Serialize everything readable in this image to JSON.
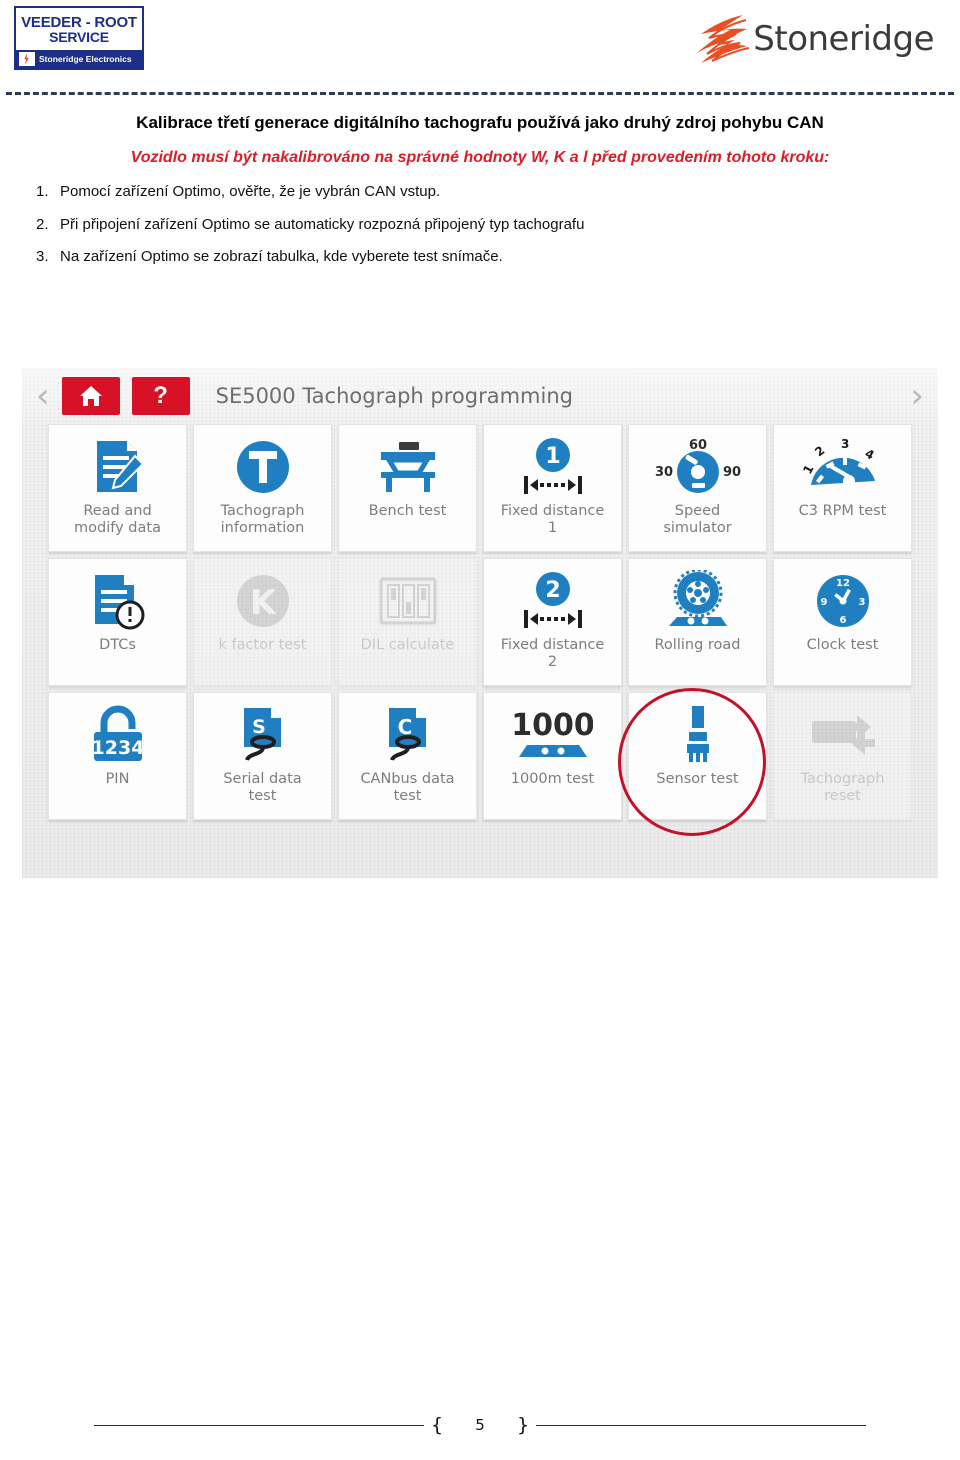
{
  "brand": {
    "veeder_root": {
      "line1": "VEEDER - ROOT",
      "line2": "SERVICE",
      "subtitle": "Stoneridge Electronics"
    },
    "stoneridge": {
      "wordmark": "Stoneridge",
      "mark_color": "#ea4f24"
    }
  },
  "document": {
    "headline": "Kalibrace třetí generace digitálního tachografu používá jako druhý zdroj pohybu CAN",
    "subline": "Vozidlo musí být nakalibrováno na správné hodnoty W, K a l před provedením tohoto kroku:",
    "steps": [
      {
        "num": "1.",
        "text": "Pomocí zařízení Optimo, ověřte, že je vybrán CAN vstup."
      },
      {
        "num": "2.",
        "text": "Při připojení zařízení Optimo se automaticky rozpozná připojený typ tachografu"
      },
      {
        "num": "3.",
        "text": "Na zařízení Optimo se zobrazí  tabulka, kde vyberete test snímače."
      }
    ],
    "page_number": "5",
    "footer_brace_left": "{",
    "footer_brace_right": "}"
  },
  "screenshot": {
    "toolbar": {
      "prev_label": "‹",
      "next_label": "›",
      "home_label": "home-button",
      "help_label": "?",
      "title": "SE5000 Tachograph programming"
    },
    "accent_red": "#d81226",
    "accent_blue": "#1f7fc0",
    "label_gray": "#7d7d7d",
    "tiles": [
      {
        "label": "Read and\nmodify data",
        "icon": "document-pencil-icon",
        "disabled": false
      },
      {
        "label": "Tachograph\ninformation",
        "icon": "tachograph-t-circle-icon",
        "disabled": false
      },
      {
        "label": "Bench test",
        "icon": "bench-icon",
        "disabled": false
      },
      {
        "label": "Fixed distance\n1",
        "icon": "fixed-distance-1-icon",
        "disabled": false
      },
      {
        "label": "Speed\nsimulator",
        "icon": "speed-dial-icon",
        "disabled": false
      },
      {
        "label": "C3 RPM test",
        "icon": "rpm-gauge-icon",
        "disabled": false
      },
      {
        "label": "DTCs",
        "icon": "document-warning-icon",
        "disabled": false
      },
      {
        "label": "k factor test",
        "icon": "k-circle-icon",
        "disabled": true
      },
      {
        "label": "DIL calculate",
        "icon": "dil-switches-icon",
        "disabled": true
      },
      {
        "label": "Fixed distance\n2",
        "icon": "fixed-distance-2-icon",
        "disabled": false
      },
      {
        "label": "Rolling road",
        "icon": "rolling-road-icon",
        "disabled": false
      },
      {
        "label": "Clock test",
        "icon": "clock-icon",
        "disabled": false
      },
      {
        "label": "PIN",
        "icon": "padlock-1234-icon",
        "disabled": false
      },
      {
        "label": "Serial data\ntest",
        "icon": "serial-data-icon",
        "disabled": false
      },
      {
        "label": "CANbus data\ntest",
        "icon": "canbus-data-icon",
        "disabled": false
      },
      {
        "label": "1000m test",
        "icon": "thousand-meter-icon",
        "disabled": false
      },
      {
        "label": "Sensor test",
        "icon": "sensor-plug-icon",
        "disabled": false
      },
      {
        "label": "Tachograph\nreset",
        "icon": "tachograph-reset-icon",
        "disabled": true
      }
    ],
    "icon_text": {
      "speed_left": "30",
      "speed_top": "60",
      "speed_right": "90",
      "rpm_1": "1",
      "rpm_2": "2",
      "rpm_3": "3",
      "rpm_4": "4",
      "fixed_1": "1",
      "fixed_2": "2",
      "pin_digits": "1234",
      "thousand": "1000",
      "serial_letter": "S",
      "canbus_letter": "C",
      "tacho_letter": "T",
      "kfactor_letter": "K",
      "clock_12": "12",
      "clock_3": "3",
      "clock_6": "6",
      "clock_9": "9"
    },
    "annotation": {
      "target": "Sensor test",
      "color": "#c31127",
      "shape": "ellipse"
    }
  }
}
